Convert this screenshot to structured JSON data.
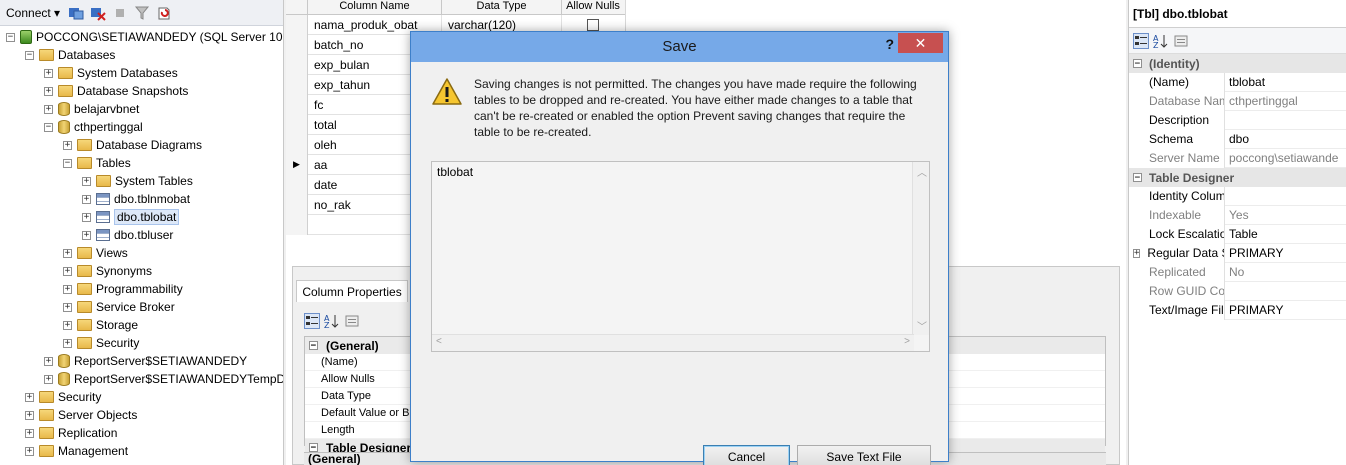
{
  "object_explorer": {
    "connect_label": "Connect",
    "tree": [
      {
        "label": "POCCONG\\SETIAWANDEDY (SQL Server 10.0",
        "level": 0,
        "icon": "server",
        "expander": "−"
      },
      {
        "label": "Databases",
        "level": 1,
        "icon": "folder",
        "expander": "−"
      },
      {
        "label": "System Databases",
        "level": 2,
        "icon": "folder",
        "expander": "+"
      },
      {
        "label": "Database Snapshots",
        "level": 2,
        "icon": "folder",
        "expander": "+"
      },
      {
        "label": "belajarvbnet",
        "level": 2,
        "icon": "database",
        "expander": "+"
      },
      {
        "label": "cthpertinggal",
        "level": 2,
        "icon": "database",
        "expander": "−"
      },
      {
        "label": "Database Diagrams",
        "level": 3,
        "icon": "folder",
        "expander": "+"
      },
      {
        "label": "Tables",
        "level": 3,
        "icon": "folder",
        "expander": "−"
      },
      {
        "label": "System Tables",
        "level": 4,
        "icon": "folder",
        "expander": "+"
      },
      {
        "label": "dbo.tblnmobat",
        "level": 4,
        "icon": "table",
        "expander": "+"
      },
      {
        "label": "dbo.tblobat",
        "level": 4,
        "icon": "table",
        "expander": "+",
        "selected": true
      },
      {
        "label": "dbo.tbluser",
        "level": 4,
        "icon": "table",
        "expander": "+"
      },
      {
        "label": "Views",
        "level": 3,
        "icon": "folder",
        "expander": "+"
      },
      {
        "label": "Synonyms",
        "level": 3,
        "icon": "folder",
        "expander": "+"
      },
      {
        "label": "Programmability",
        "level": 3,
        "icon": "folder",
        "expander": "+"
      },
      {
        "label": "Service Broker",
        "level": 3,
        "icon": "folder",
        "expander": "+"
      },
      {
        "label": "Storage",
        "level": 3,
        "icon": "folder",
        "expander": "+"
      },
      {
        "label": "Security",
        "level": 3,
        "icon": "folder",
        "expander": "+"
      },
      {
        "label": "ReportServer$SETIAWANDEDY",
        "level": 2,
        "icon": "database",
        "expander": "+"
      },
      {
        "label": "ReportServer$SETIAWANDEDYTempD",
        "level": 2,
        "icon": "database",
        "expander": "+"
      },
      {
        "label": "Security",
        "level": 1,
        "icon": "folder",
        "expander": "+"
      },
      {
        "label": "Server Objects",
        "level": 1,
        "icon": "folder",
        "expander": "+"
      },
      {
        "label": "Replication",
        "level": 1,
        "icon": "folder",
        "expander": "+"
      },
      {
        "label": "Management",
        "level": 1,
        "icon": "folder",
        "expander": "+"
      }
    ]
  },
  "designer": {
    "headers": {
      "column_name": "Column Name",
      "data_type": "Data Type",
      "allow_nulls": "Allow Nulls"
    },
    "rows": [
      {
        "name": "nama_produk_obat",
        "type": "varchar(120)"
      },
      {
        "name": "batch_no",
        "type": ""
      },
      {
        "name": "exp_bulan",
        "type": ""
      },
      {
        "name": "exp_tahun",
        "type": ""
      },
      {
        "name": "fc",
        "type": ""
      },
      {
        "name": "total",
        "type": ""
      },
      {
        "name": "oleh",
        "type": ""
      },
      {
        "name": "aa",
        "type": "",
        "current": true
      },
      {
        "name": "date",
        "type": ""
      },
      {
        "name": "no_rak",
        "type": ""
      }
    ],
    "current_row_marker": "▶",
    "column_properties_tab": "Column Properties",
    "general_category": "(General)",
    "column_props": [
      "(Name)",
      "Allow Nulls",
      "Data Type",
      "Default Value or Bi",
      "Length"
    ],
    "table_designer_category": "Table Designer",
    "bottom_label": "(General)"
  },
  "properties": {
    "title": "[Tbl] dbo.tblobat",
    "categories": [
      {
        "name": "(Identity)",
        "rows": [
          {
            "name": "(Name)",
            "value": "tblobat",
            "dim": false
          },
          {
            "name": "Database Name",
            "value": "cthpertinggal",
            "dim": true
          },
          {
            "name": "Description",
            "value": "",
            "dim": false
          },
          {
            "name": "Schema",
            "value": "dbo",
            "dim": false
          },
          {
            "name": "Server Name",
            "value": "poccong\\setiawande",
            "dim": true
          }
        ]
      },
      {
        "name": "Table Designer",
        "rows": [
          {
            "name": "Identity Column",
            "value": "",
            "dim": false
          },
          {
            "name": "Indexable",
            "value": "Yes",
            "dim": true
          },
          {
            "name": "Lock Escalation",
            "value": "Table",
            "dim": false
          },
          {
            "name": "Regular Data Spac",
            "value": "PRIMARY",
            "dim": false,
            "expander": "+"
          },
          {
            "name": "Replicated",
            "value": "No",
            "dim": true
          },
          {
            "name": "Row GUID Colum",
            "value": "",
            "dim": true
          },
          {
            "name": "Text/Image Filegr",
            "value": "PRIMARY",
            "dim": false
          }
        ]
      }
    ]
  },
  "dialog": {
    "title": "Save",
    "help": "?",
    "close": "✕",
    "message": "Saving changes is not permitted. The changes you have made require the following tables to be dropped and re-created. You have either made changes to a table that can't be re-created or enabled the option Prevent saving changes that require the table to be re-created.",
    "list_items": [
      "tblobat"
    ],
    "cancel_label": "Cancel",
    "save_text_label": "Save Text File"
  }
}
